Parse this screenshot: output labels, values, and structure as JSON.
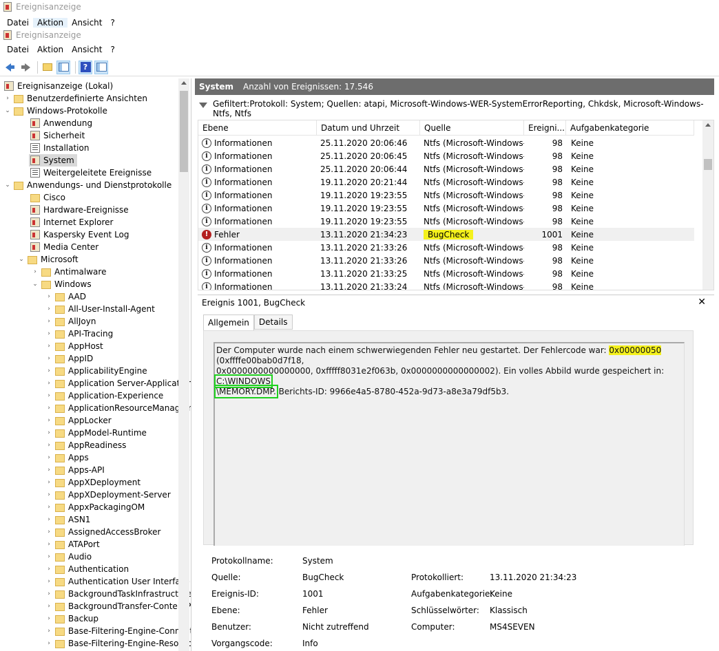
{
  "window_title": "Ereignisanzeige",
  "menu": [
    "Datei",
    "Aktion",
    "Ansicht",
    "?"
  ],
  "tree": {
    "root": "Ereignisanzeige (Lokal)",
    "custom_views": "Benutzerdefinierte Ansichten",
    "windows_logs": "Windows-Protokolle",
    "windows_logs_items": [
      "Anwendung",
      "Sicherheit",
      "Installation",
      "System",
      "Weitergeleitete Ereignisse"
    ],
    "app_logs": "Anwendungs- und Dienstprotokolle",
    "app_logs_items": [
      "Cisco",
      "Hardware-Ereignisse",
      "Internet Explorer",
      "Kaspersky Event Log",
      "Media Center"
    ],
    "microsoft": "Microsoft",
    "antimalware": "Antimalware",
    "windows": "Windows",
    "windows_children": [
      "AAD",
      "All-User-Install-Agent",
      "AllJoyn",
      "API-Tracing",
      "AppHost",
      "AppID",
      "ApplicabilityEngine",
      "Application Server-Applications",
      "Application-Experience",
      "ApplicationResourceManagement",
      "AppLocker",
      "AppModel-Runtime",
      "AppReadiness",
      "Apps",
      "Apps-API",
      "AppXDeployment",
      "AppXDeployment-Server",
      "AppxPackagingOM",
      "ASN1",
      "AssignedAccessBroker",
      "ATAPort",
      "Audio",
      "Authentication",
      "Authentication User Interface",
      "BackgroundTaskInfrastructure",
      "BackgroundTransfer-ContentPrefetcher",
      "Backup",
      "Base-Filtering-Engine-Connections",
      "Base-Filtering-Engine-Resource-Flows"
    ]
  },
  "header": {
    "log": "System",
    "count": "Anzahl von Ereignissen: 17.546"
  },
  "filter": "Gefiltert:Protokoll: System; Quellen: atapi, Microsoft-Windows-WER-SystemErrorReporting, Chkdsk, Microsoft-Windows-Ntfs, Ntfs",
  "columns": [
    "Ebene",
    "Datum und Uhrzeit",
    "Quelle",
    "Ereigni...",
    "Aufgabenkategorie"
  ],
  "rows": [
    {
      "level": "Informationen",
      "date": "25.11.2020 20:06:46",
      "source": "Ntfs (Microsoft-Windows-Ntfs)",
      "id": "98",
      "task": "Keine"
    },
    {
      "level": "Informationen",
      "date": "25.11.2020 20:06:45",
      "source": "Ntfs (Microsoft-Windows-Ntfs)",
      "id": "98",
      "task": "Keine"
    },
    {
      "level": "Informationen",
      "date": "25.11.2020 20:06:44",
      "source": "Ntfs (Microsoft-Windows-Ntfs)",
      "id": "98",
      "task": "Keine"
    },
    {
      "level": "Informationen",
      "date": "19.11.2020 20:21:44",
      "source": "Ntfs (Microsoft-Windows-Ntfs)",
      "id": "98",
      "task": "Keine"
    },
    {
      "level": "Informationen",
      "date": "19.11.2020 19:23:55",
      "source": "Ntfs (Microsoft-Windows-Ntfs)",
      "id": "98",
      "task": "Keine"
    },
    {
      "level": "Informationen",
      "date": "19.11.2020 19:23:55",
      "source": "Ntfs (Microsoft-Windows-Ntfs)",
      "id": "98",
      "task": "Keine"
    },
    {
      "level": "Informationen",
      "date": "19.11.2020 19:23:55",
      "source": "Ntfs (Microsoft-Windows-Ntfs)",
      "id": "98",
      "task": "Keine"
    },
    {
      "level": "Fehler",
      "date": "13.11.2020 21:34:23",
      "source": "BugCheck",
      "id": "1001",
      "task": "Keine"
    },
    {
      "level": "Informationen",
      "date": "13.11.2020 21:33:26",
      "source": "Ntfs (Microsoft-Windows-Ntfs)",
      "id": "98",
      "task": "Keine"
    },
    {
      "level": "Informationen",
      "date": "13.11.2020 21:33:26",
      "source": "Ntfs (Microsoft-Windows-Ntfs)",
      "id": "98",
      "task": "Keine"
    },
    {
      "level": "Informationen",
      "date": "13.11.2020 21:33:25",
      "source": "Ntfs (Microsoft-Windows-Ntfs)",
      "id": "98",
      "task": "Keine"
    },
    {
      "level": "Informationen",
      "date": "13.11.2020 21:33:24",
      "source": "Ntfs (Microsoft-Windows-Ntfs)",
      "id": "98",
      "task": "Keine"
    }
  ],
  "detail": {
    "title": "Ereignis 1001, BugCheck",
    "tabs": [
      "Allgemein",
      "Details"
    ],
    "msg_line1_a": "Der Computer wurde nach einem schwerwiegenden Fehler neu gestartet. Der Fehlercode war: ",
    "msg_code": "0x00000050",
    "msg_line1_b": " (0xffffe00bab0d7f18,",
    "msg_line2_a": "0x0000000000000000, 0xfffff8031e2f063b, 0x0000000000000002). Ein volles Abbild wurde gespeichert in: ",
    "msg_path1": "C:\\WINDOWS",
    "msg_path2": "\\MEMORY.DMP.",
    "msg_line3_b": " Berichts-ID: 9966e4a5-8780-452a-9d73-a8e3a79df5b3.",
    "props": {
      "logname_label": "Protokollname:",
      "logname": "System",
      "source_label": "Quelle:",
      "source": "BugCheck",
      "logged_label": "Protokolliert:",
      "logged": "13.11.2020 21:34:23",
      "eventid_label": "Ereignis-ID:",
      "eventid": "1001",
      "task_label": "Aufgabenkategorie:",
      "task": "Keine",
      "level_label": "Ebene:",
      "level": "Fehler",
      "keywords_label": "Schlüsselwörter:",
      "keywords": "Klassisch",
      "user_label": "Benutzer:",
      "user": "Nicht zutreffend",
      "computer_label": "Computer:",
      "computer": "MS4SEVEN",
      "opcode_label": "Vorgangscode:",
      "opcode": "Info"
    }
  }
}
